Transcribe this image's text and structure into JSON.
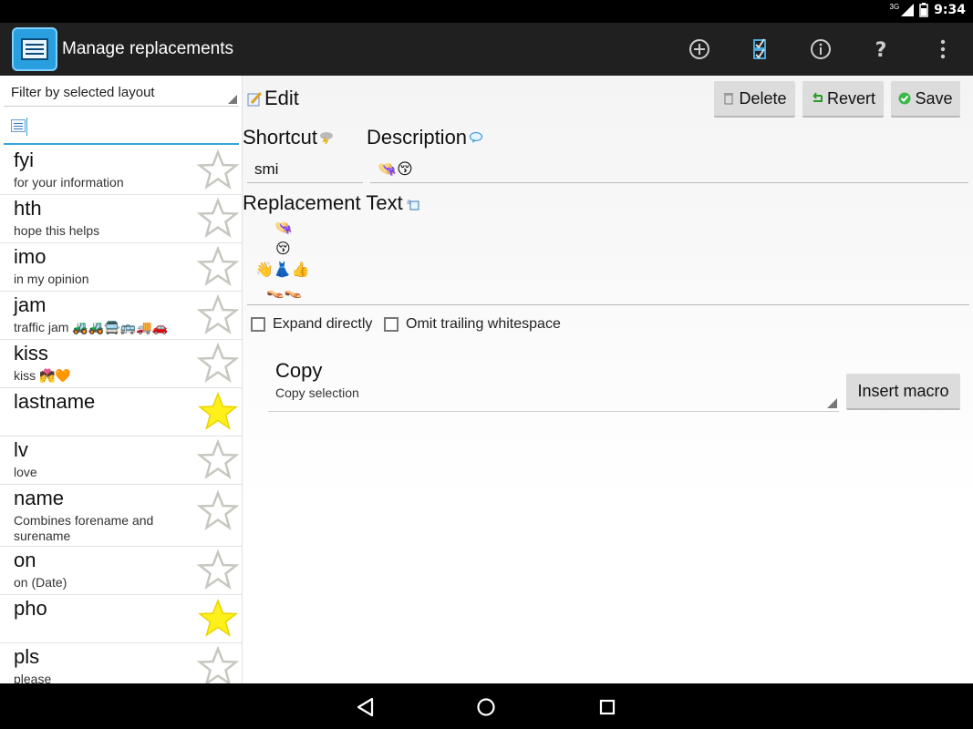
{
  "status_bar": {
    "network": "3G",
    "time": "9:34"
  },
  "action_bar": {
    "title": "Manage replacements",
    "actions": [
      {
        "name": "add-icon"
      },
      {
        "name": "checklist-icon"
      },
      {
        "name": "info-icon"
      },
      {
        "name": "help-icon"
      },
      {
        "name": "overflow-menu-icon"
      }
    ]
  },
  "sidebar": {
    "filter_label": "Filter by selected layout",
    "search_value": "",
    "items": [
      {
        "shortcut": "fyi",
        "description": "for your information",
        "starred": false
      },
      {
        "shortcut": "hth",
        "description": "hope this helps",
        "starred": false
      },
      {
        "shortcut": "imo",
        "description": "in my opinion",
        "starred": false
      },
      {
        "shortcut": "jam",
        "description": "traffic jam 🚜🚜🚍🚌🚚🚗",
        "starred": false
      },
      {
        "shortcut": "kiss",
        "description": "kiss 💏🧡",
        "starred": false
      },
      {
        "shortcut": "lastname",
        "description": "",
        "starred": true
      },
      {
        "shortcut": "lv",
        "description": "love",
        "starred": false
      },
      {
        "shortcut": "name",
        "description": "Combines forename and surename",
        "starred": false
      },
      {
        "shortcut": "on",
        "description": "on (Date)",
        "starred": false
      },
      {
        "shortcut": "pho",
        "description": "",
        "starred": true
      },
      {
        "shortcut": "pls",
        "description": "please",
        "starred": false
      }
    ]
  },
  "editor": {
    "edit_label": "Edit",
    "delete_label": "Delete",
    "revert_label": "Revert",
    "save_label": "Save",
    "shortcut_label": "Shortcut",
    "shortcut_value": "smi",
    "description_label": "Description",
    "description_value": "👒😚",
    "replacement_label": "Replacement Text",
    "replacement_lines": [
      "👒",
      "😚",
      "👋👗👍",
      "👡👡"
    ],
    "expand_directly_label": "Expand directly",
    "expand_directly_checked": false,
    "omit_whitespace_label": "Omit trailing whitespace",
    "omit_whitespace_checked": false,
    "macro_title": "Copy",
    "macro_subtitle": "Copy selection",
    "insert_macro_label": "Insert macro"
  },
  "colors": {
    "accent": "#35a5d8",
    "star_active": "#ffef1a",
    "star_inactive": "#c7c7c0"
  }
}
